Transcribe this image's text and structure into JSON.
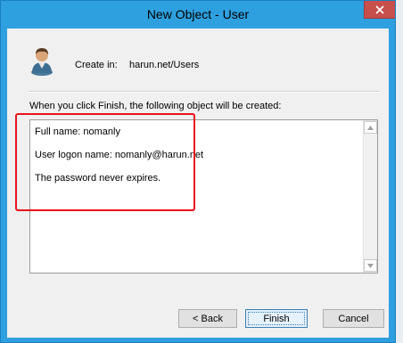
{
  "window": {
    "title": "New Object - User"
  },
  "header": {
    "create_in_label": "Create in:",
    "create_in_path": "harun.net/Users"
  },
  "info_text": "When you click Finish, the following object will be created:",
  "summary": {
    "lines": [
      "Full name: nomanly",
      "User logon name: nomanly@harun.net",
      "The password never expires."
    ]
  },
  "buttons": {
    "back": "< Back",
    "finish": "Finish",
    "cancel": "Cancel"
  },
  "colors": {
    "titlebar": "#2ea0df",
    "close_button": "#c74f4c",
    "highlight_box": "#e8141a"
  }
}
